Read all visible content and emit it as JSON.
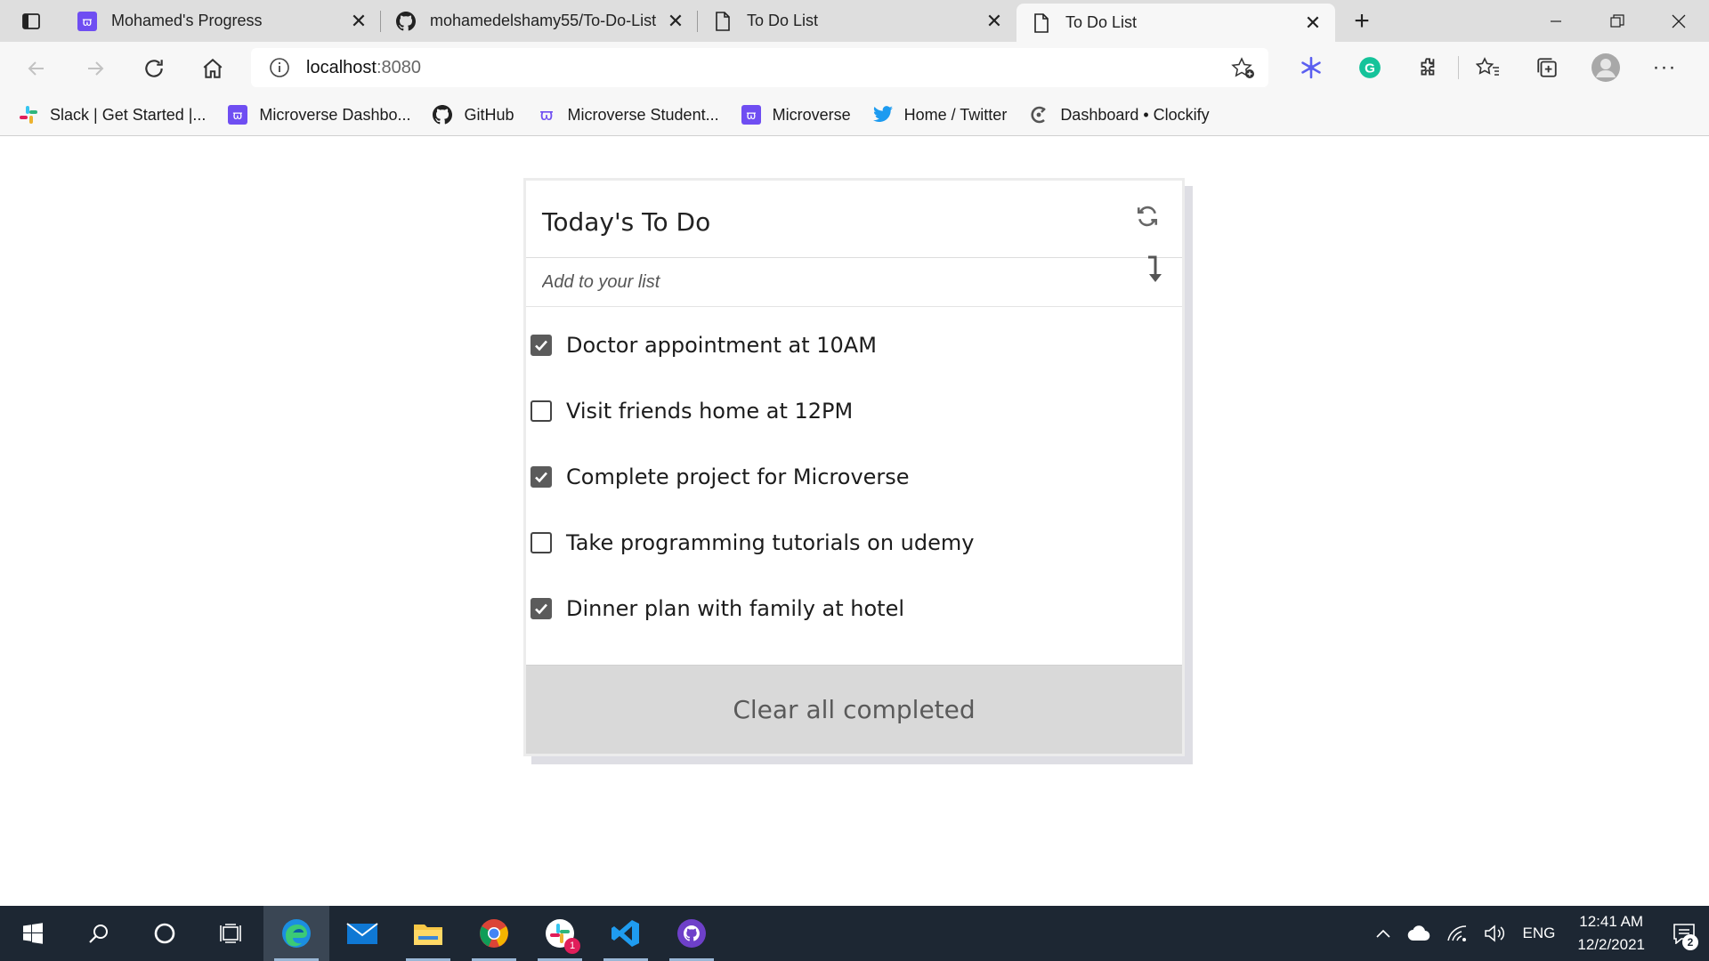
{
  "browser": {
    "tabs": [
      {
        "title": "Mohamed's Progress",
        "icon": "microverse-icon",
        "active": false
      },
      {
        "title": "mohamedelshamy55/To-Do-List",
        "icon": "github-icon",
        "active": false
      },
      {
        "title": "To Do List",
        "icon": "page-icon",
        "active": false
      },
      {
        "title": "To Do List",
        "icon": "page-icon",
        "active": true
      }
    ],
    "address": {
      "host": "localhost",
      "port": ":8080"
    },
    "bookmarks": [
      {
        "label": "Slack | Get Started |...",
        "icon": "slack-icon"
      },
      {
        "label": "Microverse Dashbo...",
        "icon": "microverse-icon"
      },
      {
        "label": "GitHub",
        "icon": "github-icon"
      },
      {
        "label": "Microverse Student...",
        "icon": "microverse-outline-icon"
      },
      {
        "label": "Microverse",
        "icon": "microverse-icon"
      },
      {
        "label": "Home / Twitter",
        "icon": "twitter-icon"
      },
      {
        "label": "Dashboard • Clockify",
        "icon": "clockify-icon"
      }
    ],
    "colors": {
      "microverse": "#6f4ef2",
      "twitter": "#1d9bf0",
      "grammarly": "#15c39a",
      "ext_purple": "#5b5ff0"
    }
  },
  "todo": {
    "title": "Today's To Do",
    "input_placeholder": "Add to your list",
    "items": [
      {
        "text": "Doctor appointment at 10AM",
        "completed": true
      },
      {
        "text": "Visit friends home at 12PM",
        "completed": false
      },
      {
        "text": "Complete project for Microverse",
        "completed": true
      },
      {
        "text": "Take programming tutorials on udemy",
        "completed": false
      },
      {
        "text": "Dinner plan with family at hotel",
        "completed": true
      }
    ],
    "clear_label": "Clear all completed"
  },
  "taskbar": {
    "time": "12:41 AM",
    "date": "12/2/2021",
    "language": "ENG",
    "slack_badge": "1",
    "notification_count": "2"
  }
}
